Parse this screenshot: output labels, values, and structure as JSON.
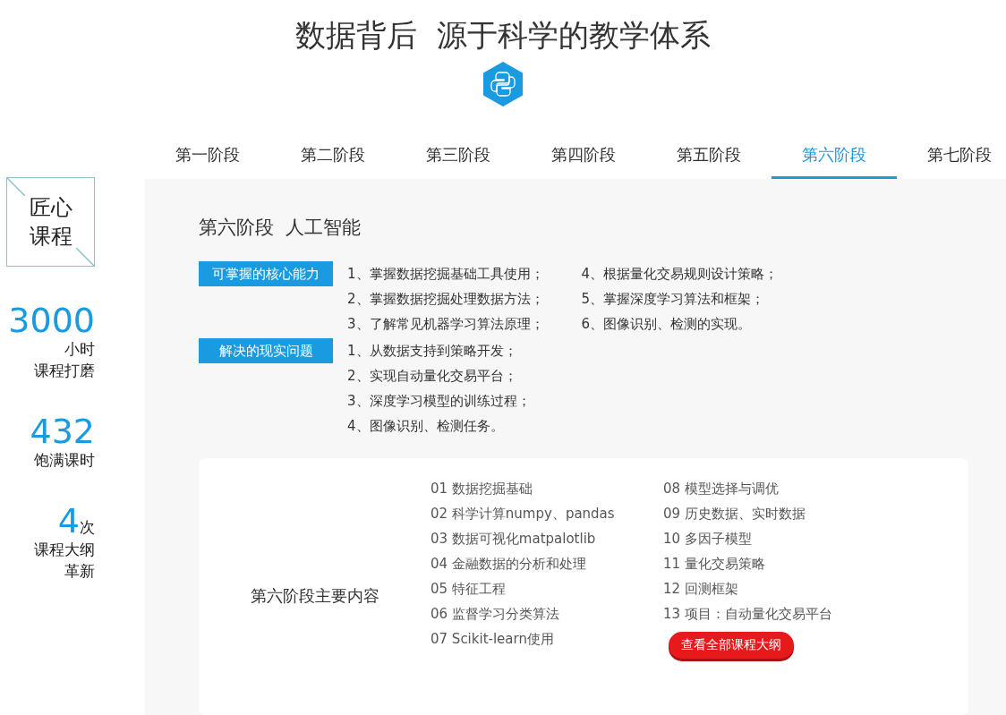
{
  "header": {
    "title": "数据背后  源于科学的教学体系"
  },
  "tabs": [
    {
      "label": "第一阶段",
      "selected": false
    },
    {
      "label": "第二阶段",
      "selected": false
    },
    {
      "label": "第三阶段",
      "selected": false
    },
    {
      "label": "第四阶段",
      "selected": false
    },
    {
      "label": "第五阶段",
      "selected": false
    },
    {
      "label": "第六阶段",
      "selected": true
    },
    {
      "label": "第七阶段",
      "selected": false
    }
  ],
  "sidebar": {
    "badge": [
      "匠心",
      "课程"
    ],
    "stats": [
      {
        "number": "3000",
        "lines": [
          "小时",
          "课程打磨"
        ]
      },
      {
        "number": "432",
        "lines": [
          "饱满课时"
        ]
      },
      {
        "number": "4",
        "unit": "次",
        "lines": [
          "课程大纲",
          "革新"
        ]
      }
    ]
  },
  "stage": {
    "heading": "第六阶段  人工智能",
    "sections": [
      {
        "tag": "可掌握的核心能力",
        "columns": [
          [
            "1、掌握数据挖掘基础工具使用；",
            "2、掌握数据挖掘处理数据方法；",
            "3、了解常见机器学习算法原理；"
          ],
          [
            "4、根据量化交易规则设计策略；",
            "5、掌握深度学习算法和框架；",
            "6、图像识别、检测的实现。"
          ]
        ]
      },
      {
        "tag": "解决的现实问题",
        "columns": [
          [
            "1、从数据支持到策略开发；",
            "2、实现自动量化交易平台；",
            "3、深度学习模型的训练过程；",
            "4、图像识别、检测任务。"
          ]
        ]
      }
    ],
    "content": {
      "label": "第六阶段主要内容",
      "columns": [
        [
          "01 数据挖掘基础",
          "02 科学计算numpy、pandas",
          "03 数据可视化matpalotlib",
          "04 金融数据的分析和处理",
          "05 特征工程",
          "06 监督学习分类算法",
          "07 Scikit-learn使用"
        ],
        [
          "08 模型选择与调优",
          "09 历史数据、实时数据",
          "10 多因子模型",
          "11 量化交易策略",
          "12 回测框架",
          "13 项目：自动量化交易平台"
        ]
      ],
      "button": "查看全部课程大纲"
    }
  }
}
